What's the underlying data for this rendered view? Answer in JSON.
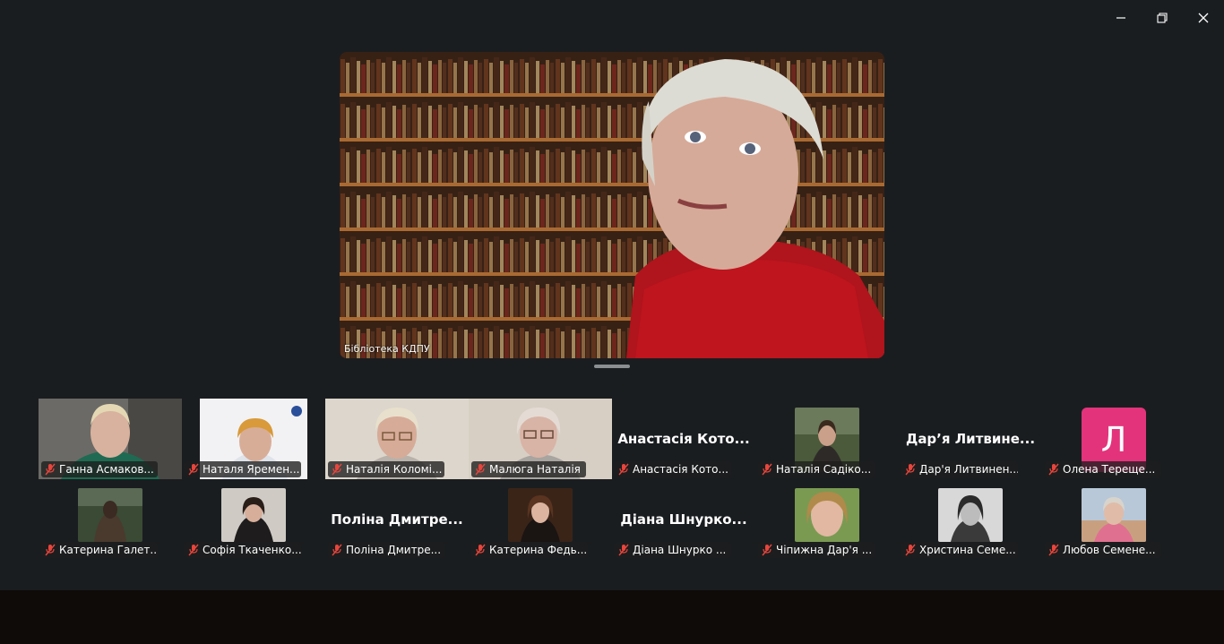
{
  "window_controls": {
    "minimize_icon": "minimize-icon",
    "restore_icon": "restore-icon",
    "close_icon": "close-icon"
  },
  "speaker": {
    "name": "Бібліотека КДПУ"
  },
  "participants_row1": [
    {
      "name": "Ганна Асмаков...",
      "video": true,
      "scene": "woman-green"
    },
    {
      "name": "Наталя Яремен...",
      "video": true,
      "scene": "woman-white"
    },
    {
      "name": "Наталія Коломі...",
      "video": true,
      "scene": "woman-glasses"
    },
    {
      "name": "Малюга Наталія",
      "video": true,
      "scene": "woman-grey"
    },
    {
      "name": "Анастасія Кото...",
      "video": false,
      "big_name": "Анастасія Кото..."
    },
    {
      "name": "Наталія Садіко...",
      "video": false,
      "photo": true,
      "scene": "photo-outdoor"
    },
    {
      "name": "Дар'я Литвинен...",
      "video": false,
      "big_name": "Дар’я Литвине..."
    },
    {
      "name": "Олена Терещe...",
      "video": false,
      "avatar_letter": "Л"
    }
  ],
  "participants_row2": [
    {
      "name": "Катерина Галет...",
      "photo": true,
      "scene": "photo-forest"
    },
    {
      "name": "Софія Ткаченко...",
      "photo": true,
      "scene": "photo-dark"
    },
    {
      "name": "Поліна Дмитре...",
      "big_name": "Поліна Дмитре..."
    },
    {
      "name": "Катерина Федь...",
      "photo": true,
      "scene": "photo-brown"
    },
    {
      "name": "Діана Шнурко ...",
      "big_name": "Діана Шнурко..."
    },
    {
      "name": "Чіпижна Дар'я ...",
      "photo": true,
      "scene": "photo-green"
    },
    {
      "name": "Христина Семе...",
      "photo": true,
      "scene": "photo-bw"
    },
    {
      "name": "Любов Семене...",
      "photo": true,
      "scene": "photo-sky"
    }
  ],
  "colors": {
    "background": "#1a1d20",
    "muted_mic": "#e8453c",
    "avatar_pink": "#e3337b"
  }
}
